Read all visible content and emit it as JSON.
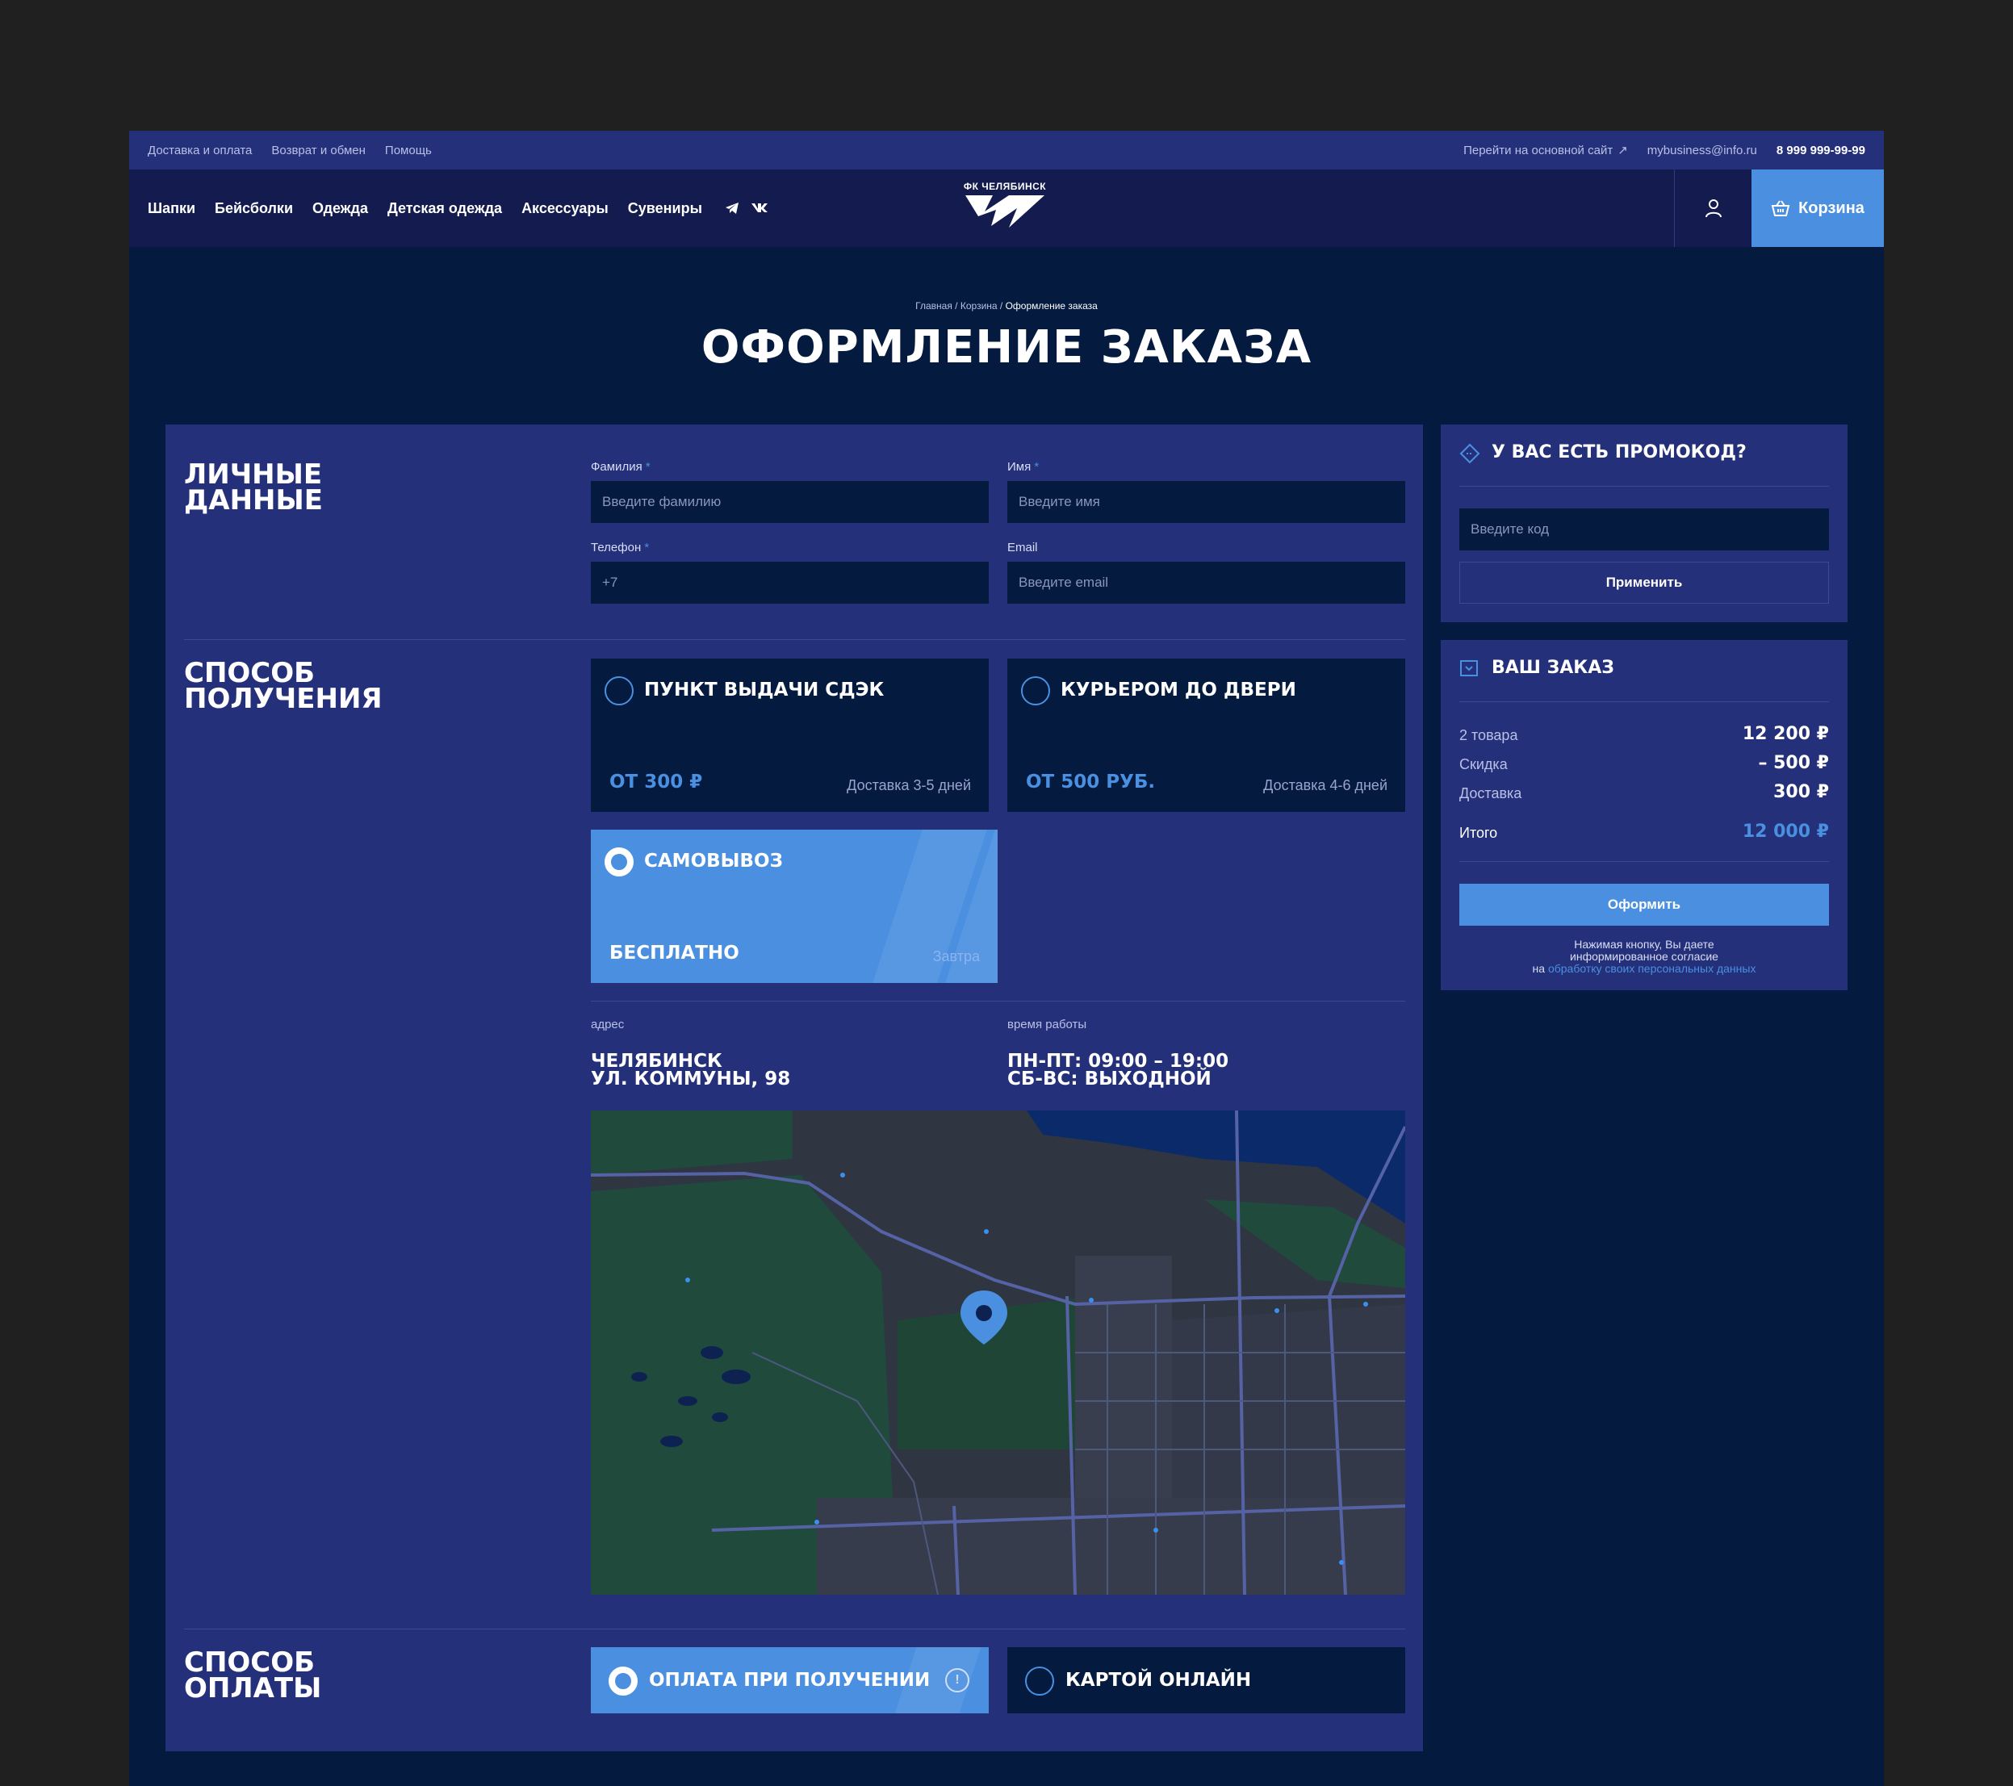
{
  "topbar": {
    "links": [
      "Доставка и оплата",
      "Возврат и обмен",
      "Помощь"
    ],
    "main_site": "Перейти на основной сайт",
    "email": "mybusiness@info.ru",
    "phone": "8 999 999-99-99"
  },
  "header": {
    "nav": [
      "Шапки",
      "Бейсболки",
      "Одежда",
      "Детская одежда",
      "Аксессуары",
      "Сувениры"
    ],
    "logo_text": "ФК ЧЕЛЯБИНСК",
    "cart_label": "Корзина"
  },
  "breadcrumbs": [
    "Главная",
    "Корзина",
    "Оформление заказа"
  ],
  "page_title": "ОФОРМЛЕНИЕ ЗАКАЗА",
  "personal": {
    "title_1": "ЛИЧНЫЕ",
    "title_2": "ДАННЫЕ",
    "surname_label": "Фамилия",
    "surname_placeholder": "Введите фамилию",
    "name_label": "Имя",
    "name_placeholder": "Введите имя",
    "phone_label": "Телефон",
    "phone_value": "+7",
    "email_label": "Email",
    "email_placeholder": "Введите email",
    "required_mark": "*"
  },
  "delivery": {
    "title_1": "СПОСОБ",
    "title_2": "ПОЛУЧЕНИЯ",
    "options": [
      {
        "name": "ПУНКТ ВЫДАЧИ СДЭК",
        "price": "ОТ 300 ₽",
        "term": "Доставка 3-5 дней",
        "selected": false
      },
      {
        "name": "КУРЬЕРОМ ДО ДВЕРИ",
        "price": "ОТ 500 РУБ.",
        "term": "Доставка 4-6 дней",
        "selected": false
      },
      {
        "name": "САМОВЫВОЗ",
        "price": "БЕСПЛАТНО",
        "term": "Завтра",
        "selected": true
      }
    ],
    "address_label": "адрес",
    "address_1": "ЧЕЛЯБИНСК",
    "address_2": "УЛ. КОММУНЫ, 98",
    "hours_label": "время работы",
    "hours_1": "ПН-ПТ: 09:00 – 19:00",
    "hours_2": "СБ-ВС: ВЫХОДНОЙ"
  },
  "payment": {
    "title_1": "СПОСОБ",
    "title_2": "ОПЛАТЫ",
    "options": [
      {
        "name": "ОПЛАТА ПРИ ПОЛУЧЕНИИ",
        "selected": true
      },
      {
        "name": "КАРТОЙ ОНЛАЙН",
        "selected": false
      }
    ]
  },
  "promo": {
    "title": "У ВАС ЕСТЬ ПРОМОКОД?",
    "placeholder": "Введите код",
    "apply": "Применить"
  },
  "order": {
    "title": "ВАШ ЗАКАЗ",
    "items_label": "2 товара",
    "items_value": "12 200 ₽",
    "discount_label": "Скидка",
    "discount_value": "– 500 ₽",
    "delivery_label": "Доставка",
    "delivery_value": "300 ₽",
    "total_label": "Итого",
    "total_value": "12 000 ₽",
    "submit": "Оформить",
    "consent_1": "Нажимая кнопку, Вы даете",
    "consent_2": "информированное согласие",
    "consent_3": "на",
    "consent_link": "обработку своих персональных данных"
  },
  "colors": {
    "accent": "#4a8fe0",
    "panel": "#25307a",
    "page_bg": "#051a3f",
    "header_bg": "#141b4e"
  }
}
